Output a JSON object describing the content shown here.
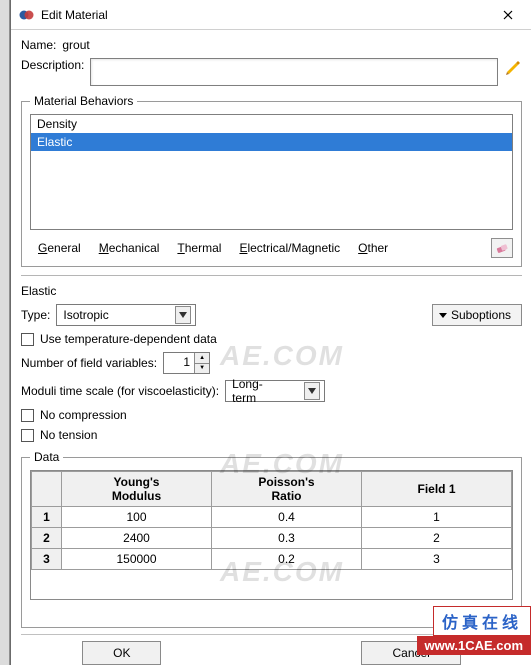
{
  "window": {
    "title": "Edit Material"
  },
  "nameRow": {
    "label": "Name:",
    "value": "grout"
  },
  "descRow": {
    "label": "Description:",
    "value": ""
  },
  "behaviors": {
    "legend": "Material Behaviors",
    "items": [
      "Density",
      "Elastic"
    ],
    "selectedIndex": 1
  },
  "tabs": {
    "general": "General",
    "mechanical": "Mechanical",
    "thermal": "Thermal",
    "electrical": "Electrical/Magnetic",
    "other": "Other"
  },
  "elastic": {
    "sectionTitle": "Elastic",
    "typeLabel": "Type:",
    "typeValue": "Isotropic",
    "suboptions": "Suboptions",
    "tempDep": "Use temperature-dependent data",
    "fieldVarsLabel": "Number of field variables:",
    "fieldVarsValue": "1",
    "moduliLabel": "Moduli time scale (for viscoelasticity):",
    "moduliValue": "Long-term",
    "noCompression": "No compression",
    "noTension": "No tension",
    "dataLegend": "Data",
    "columns": {
      "c1": "Young's\nModulus",
      "c2": "Poisson's\nRatio",
      "c3": "Field 1"
    },
    "rows": [
      {
        "n": "1",
        "ym": "100",
        "pr": "0.4",
        "f1": "1"
      },
      {
        "n": "2",
        "ym": "2400",
        "pr": "0.3",
        "f1": "2"
      },
      {
        "n": "3",
        "ym": "150000",
        "pr": "0.2",
        "f1": "3"
      }
    ]
  },
  "buttons": {
    "ok": "OK",
    "cancel": "Cancel"
  },
  "watermark": "AE.COM",
  "overlay": {
    "cn": "仿真在线",
    "url": "www.1CAE.com"
  }
}
